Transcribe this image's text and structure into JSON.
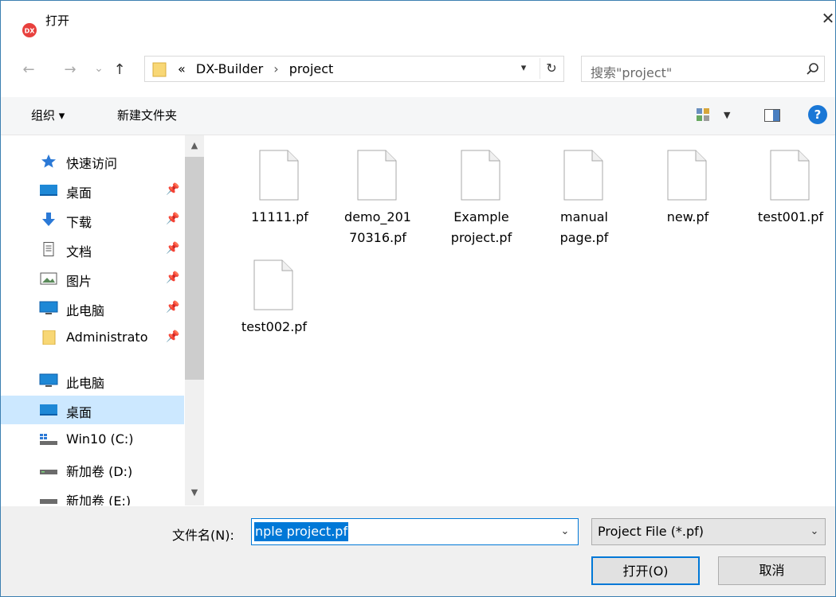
{
  "title": "打开",
  "nav": {
    "back": "←",
    "forward": "→",
    "recent": "⌄",
    "up": "↑"
  },
  "address": {
    "prefix": "«",
    "segments": [
      "DX-Builder",
      "project"
    ],
    "separator": "›"
  },
  "search": {
    "placeholder": "搜索\"project\""
  },
  "toolbar": {
    "organize": "组织 ▾",
    "new_folder": "新建文件夹",
    "help": "?"
  },
  "sidebar": {
    "items": [
      {
        "label": "快速访问"
      },
      {
        "label": "桌面"
      },
      {
        "label": "下载"
      },
      {
        "label": "文档"
      },
      {
        "label": "图片"
      },
      {
        "label": "此电脑"
      },
      {
        "label": "Administrato"
      },
      {
        "label": "此电脑"
      },
      {
        "label": "桌面"
      },
      {
        "label": "Win10 (C:)"
      },
      {
        "label": "新加卷 (D:)"
      },
      {
        "label": "新加卷 (E:)"
      }
    ]
  },
  "files": [
    {
      "name": "11111.pf"
    },
    {
      "name": "demo_20170316.pf"
    },
    {
      "name": "Example project.pf"
    },
    {
      "name": "manual page.pf"
    },
    {
      "name": "new.pf"
    },
    {
      "name": "test001.pf"
    },
    {
      "name": "test002.pf"
    }
  ],
  "file_name_rows": [
    [
      "11111.pf"
    ],
    [
      "demo_201",
      "70316.pf"
    ],
    [
      "Example",
      "project.pf"
    ],
    [
      "manual",
      "page.pf"
    ],
    [
      "new.pf"
    ],
    [
      "test001.pf"
    ],
    [
      "test002.pf"
    ]
  ],
  "bottom": {
    "filename_label": "文件名(N):",
    "filename_value": "nple project.pf",
    "filetype": "Project File (*.pf)",
    "open_button": "打开(O)",
    "cancel_button": "取消"
  },
  "colors": {
    "accent": "#0078d7",
    "selection": "#cce8ff",
    "folder": "#f8d775",
    "app_icon": "#e8403d"
  }
}
